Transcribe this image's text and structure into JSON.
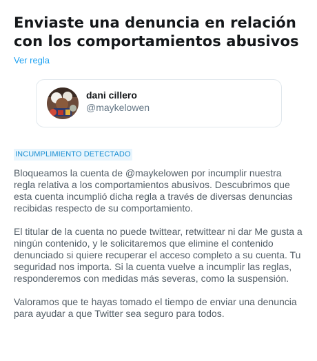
{
  "notice": {
    "title": "Enviaste una denuncia en relación con los comportamientos abusivos",
    "rule_link": "Ver regla"
  },
  "reported_account": {
    "display_name": "dani cillero",
    "handle": "@maykelowen",
    "avatar_icon": "profile-photo"
  },
  "status_badge": "INCUMPLIMIENTO DETECTADO",
  "body": {
    "paragraph_1": "Bloqueamos la cuenta de @maykelowen por incumplir nuestra regla relativa a los comportamientos abusivos. Descubrimos que esta cuenta incumplió dicha regla a través de diversas denuncias recibidas respecto de su comportamiento.",
    "paragraph_2": "El titular de la cuenta no puede twittear, retwittear ni dar Me gusta a ningún contenido, y le solicitaremos que elimine el contenido denunciado si quiere recuperar el acceso completo a su cuenta. Tu seguridad nos importa. Si la cuenta vuelve a incumplir las reglas, responderemos con medidas más severas, como la suspensión.",
    "paragraph_3": "Valoramos que te hayas tomado el tiempo de enviar una denuncia para ayudar a que Twitter sea seguro para todos."
  },
  "colors": {
    "link": "#1da1f2",
    "badge_bg": "#e8f5fd",
    "badge_text": "#1b8fd2",
    "body_text": "#525d66",
    "title_text": "#14171a"
  }
}
